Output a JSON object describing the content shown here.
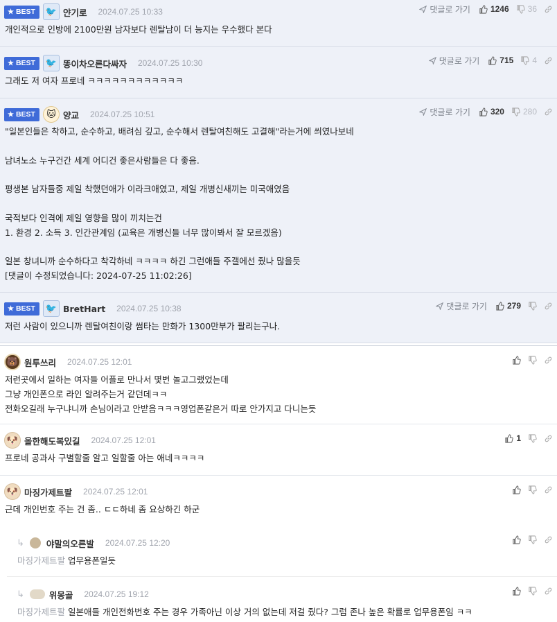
{
  "labels": {
    "best": "BEST",
    "goto": "댓글로 가기"
  },
  "colors": {
    "best_badge": "#3f6bd8",
    "best_bg": "#eef1f8"
  },
  "comments": [
    {
      "best": true,
      "avatar": "bird-icon",
      "nick": "얀기로",
      "date": "2024.07.25 10:33",
      "up": "1246",
      "down": "36",
      "body": "개인적으로 인방에 2100만원 남자보다 렌탈남이 더 능지는 우수했다 본다"
    },
    {
      "best": true,
      "avatar": "bird-icon",
      "nick": "똥이차오른다싸자",
      "date": "2024.07.25 10:30",
      "up": "715",
      "down": "4",
      "body": "그래도 저 여자 프로네 ㅋㅋㅋㅋㅋㅋㅋㅋㅋㅋㅋㅋ"
    },
    {
      "best": true,
      "avatar": "cat-icon",
      "nick": "양교",
      "date": "2024.07.25 10:51",
      "up": "320",
      "down": "280",
      "body": "\"일본인들은 착하고, 순수하고, 배려심 깊고, 순수해서 렌탈여친해도 고결해\"라는거에 씌였나보네\n\n남녀노소 누구건간 세계 어디건 좋은사람들은 다 좋음.\n\n평생본 남자들중 제일 착했던애가 이라크애였고, 제일 개병신새끼는 미국애였음\n\n국적보다 인격에 제일 영향을 많이 끼치는건\n1. 환경 2. 소득 3. 인간관계임 (교육은 개병신들 너무 많이봐서 잘 모르겠음)\n\n일본 창녀니까 순수하다고 착각하네 ㅋㅋㅋㅋ 하긴 그런애들 주갤에선 줬나 많을듯\n[댓글이 수정되었습니다: 2024-07-25 11:02:26]"
    },
    {
      "best": true,
      "avatar": "bird-icon",
      "nick": "BretHart",
      "date": "2024.07.25 10:38",
      "up": "279",
      "down": "",
      "body": "저런 사람이 있으니까 렌탈여친이랑 썸타는 만화가 1300만부가 팔리는구나."
    },
    {
      "best": false,
      "avatar": "bear-icon",
      "nick": "원투쓰리",
      "date": "2024.07.25 12:01",
      "up": "",
      "down": "",
      "body": "저런곳에서 일하는 여자들 어플로 만나서 몇번 놀고그랬었는데\n그냥 개인폰으로 라인 알려주는거 같던데ㅋㅋ\n전화오길래 누구냐니까 손님이라고 안받음ㅋㅋㅋ영업폰같은거 따로 안가지고 다니는듯"
    },
    {
      "best": false,
      "avatar": "dog-icon",
      "nick": "올한해도복있길",
      "date": "2024.07.25 12:01",
      "up": "1",
      "down": "",
      "body": "프로네 공과사 구별할줄 알고 일할줄 아는 애네ㅋㅋㅋㅋ"
    },
    {
      "best": false,
      "avatar": "dog-icon",
      "nick": "마징가제트팔",
      "date": "2024.07.25 12:01",
      "up": "",
      "down": "",
      "body": "근데 개인번호 주는 건 좀.. ㄷㄷ하네 좀 요상하긴 하군"
    }
  ],
  "replies": [
    {
      "avatar": "dot-icon",
      "nick": "야말의오른발",
      "date": "2024.07.25 12:20",
      "mention": "마징가제트팔",
      "body": "업무용폰일듯"
    },
    {
      "avatar": "cloud-icon",
      "nick": "위몽골",
      "date": "2024.07.25 19:12",
      "mention": "마징가제트팔",
      "body": "일본애들 개인전화번호 주는 경우 가족아닌 이상 거의 없는데 저걸 줬다? 그럼 존나 높은 확률로 업무용폰임 ㅋㅋ"
    }
  ]
}
